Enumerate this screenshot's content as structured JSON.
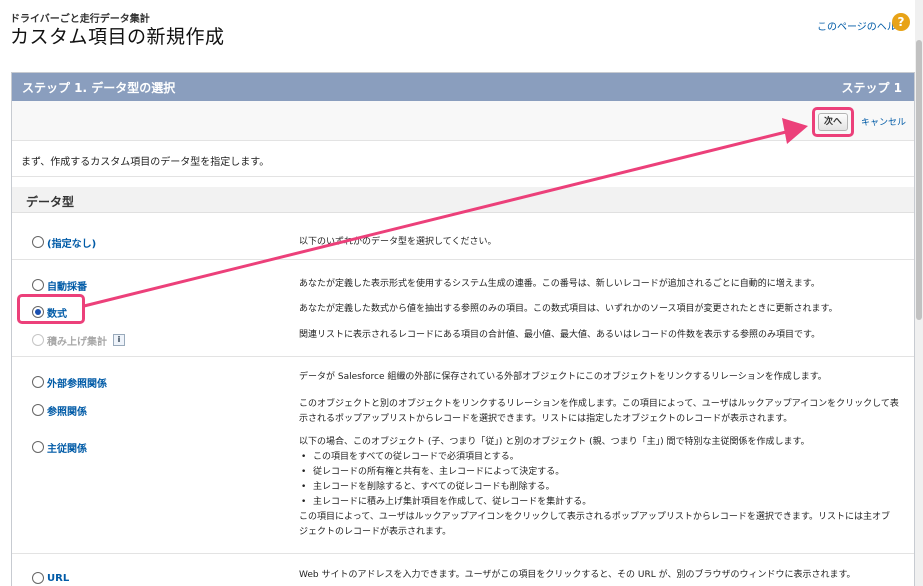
{
  "header": {
    "breadcrumb": "ドライバーごと走行データ集計",
    "title": "カスタム項目の新規作成",
    "help_link": "このページのヘルプ",
    "help_icon": "?"
  },
  "step": {
    "title": "ステップ 1. データ型の選択",
    "number": "ステップ 1"
  },
  "buttons": {
    "next": "次へ",
    "cancel": "キャンセル"
  },
  "intro": "まず、作成するカスタム項目のデータ型を指定します。",
  "section": {
    "title": "データ型"
  },
  "options": [
    {
      "label": "(指定なし)",
      "desc": "以下のいずれかのデータ型を選択してください。"
    },
    {
      "label": "自動採番",
      "desc": "あなたが定義した表示形式を使用するシステム生成の連番。この番号は、新しいレコードが追加されるごとに自動的に増えます。"
    },
    {
      "label": "数式",
      "desc": "あなたが定義した数式から値を抽出する参照のみの項目。この数式項目は、いずれかのソース項目が変更されたときに更新されます。"
    },
    {
      "label": "積み上げ集計",
      "info": "i",
      "desc": "関連リストに表示されるレコードにある項目の合計値、最小値、最大値、あるいはレコードの件数を表示する参照のみ項目です。"
    },
    {
      "label": "外部参照関係",
      "desc": "データが Salesforce 組織の外部に保存されている外部オブジェクトにこのオブジェクトをリンクするリレーションを作成します。"
    },
    {
      "label": "参照関係",
      "desc": "このオブジェクトと別のオブジェクトをリンクするリレーションを作成します。この項目によって、ユーザはルックアップアイコンをクリックして表示されるポップアップリストからレコードを選択できます。リストには指定したオブジェクトのレコードが表示されます。"
    },
    {
      "label": "主従関係",
      "desc": "以下の場合、このオブジェクト (子、つまり「従」) と別のオブジェクト (親、つまり「主」) 間で特別な主従関係を作成します。",
      "bullets": [
        "この項目をすべての従レコードで必須項目とする。",
        "従レコードの所有権と共有を、主レコードによって決定する。",
        "主レコードを削除すると、すべての従レコードも削除する。",
        "主レコードに積み上げ集計項目を作成して、従レコードを集計する。"
      ],
      "desc2": "この項目によって、ユーザはルックアップアイコンをクリックして表示されるポップアップリストからレコードを選択できます。リストには主オブジェクトのレコードが表示されます。"
    },
    {
      "label": "URL",
      "desc": "Web サイトのアドレスを入力できます。ユーザがこの項目をクリックすると、その URL が、別のブラウザのウィンドウに表示されます。"
    }
  ],
  "colors": {
    "step_header": "#8a9ebe",
    "link": "#015ba7",
    "highlight": "#ec407a"
  }
}
